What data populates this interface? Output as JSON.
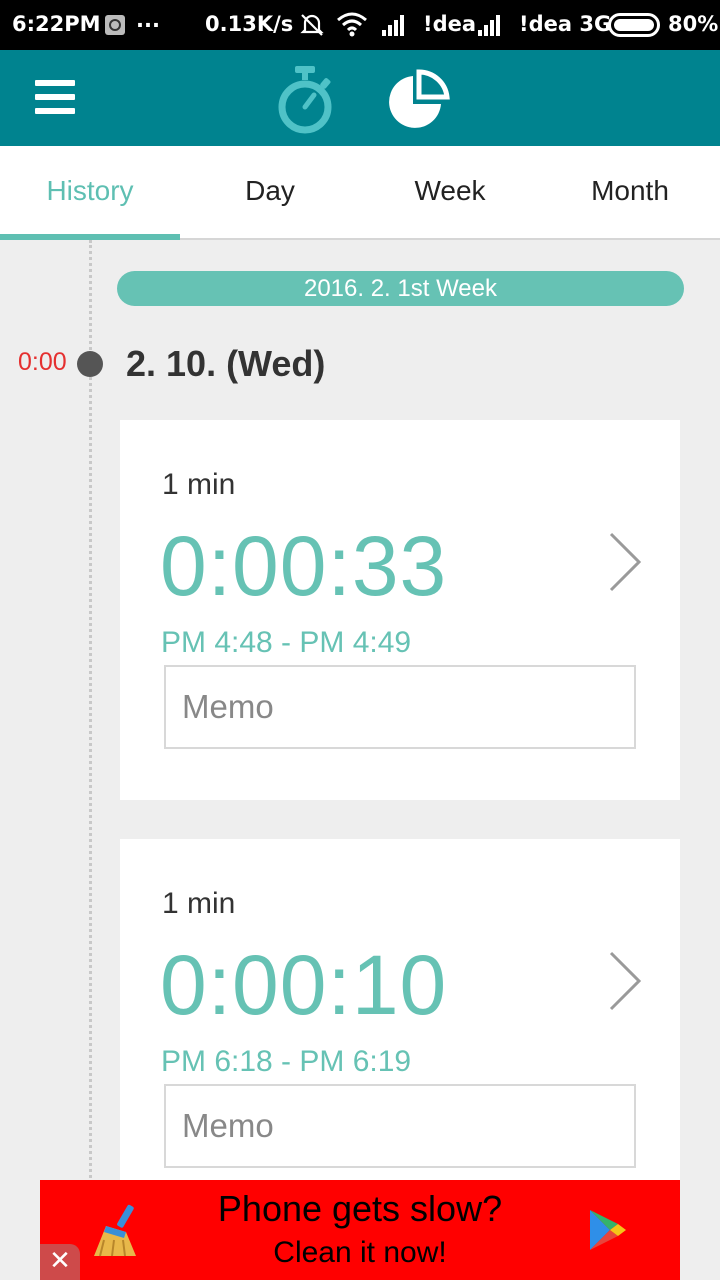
{
  "status_bar": {
    "time": "6:22PM",
    "dots": "...",
    "speed": "0.13K/s",
    "carrier1": "!dea",
    "carrier2": "!dea 3G",
    "battery": "80%"
  },
  "app_bar": {
    "menu_icon": "hamburger-menu-icon",
    "timer_icon": "stopwatch-icon",
    "stats_icon": "pie-chart-icon",
    "color": "#00838f"
  },
  "tabs": [
    {
      "label": "History",
      "active": true
    },
    {
      "label": "Day",
      "active": false
    },
    {
      "label": "Week",
      "active": false
    },
    {
      "label": "Month",
      "active": false
    }
  ],
  "timeline": {
    "week_label": "2016. 2. 1st Week",
    "time_marker": "0:00",
    "day_title": "2. 10. (Wed)"
  },
  "entries": [
    {
      "duration": "1 min",
      "elapsed": "0:00:33",
      "range": "PM 4:48 - PM 4:49",
      "memo_placeholder": "Memo"
    },
    {
      "duration": "1 min",
      "elapsed": "0:00:10",
      "range": "PM 6:18 - PM 6:19",
      "memo_placeholder": "Memo"
    }
  ],
  "ad": {
    "line1": "Phone gets slow?",
    "line2": "Clean it now!",
    "close": "✕"
  },
  "colors": {
    "accent": "#5ebfb2",
    "marker": "#e53030",
    "ad_bg": "#ff0000"
  }
}
